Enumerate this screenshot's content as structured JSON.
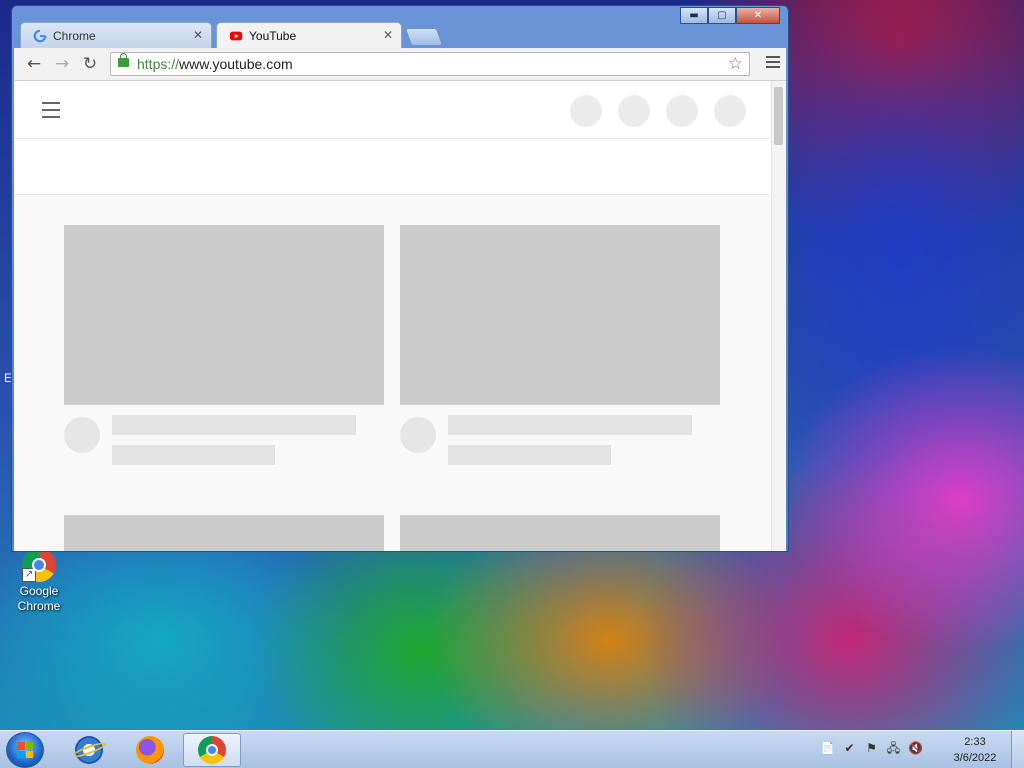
{
  "desktop": {
    "icons": [
      {
        "label_line1": "Google",
        "label_line2": "Chrome"
      }
    ],
    "stray_char": "E"
  },
  "browser": {
    "window_buttons": {
      "minimize": "▬",
      "maximize": "▢",
      "close": "✕"
    },
    "tabs": [
      {
        "title": "Chrome",
        "active": false,
        "favicon": "google-g-icon"
      },
      {
        "title": "YouTube",
        "active": true,
        "favicon": "youtube-icon"
      }
    ],
    "tab_close_glyph": "✕",
    "toolbar": {
      "back_glyph": "←",
      "forward_glyph": "→",
      "reload_glyph": "↻",
      "url_scheme": "https://",
      "url_rest": "www.youtube.com",
      "star_glyph": "☆"
    }
  },
  "taskbar": {
    "pinned": [
      {
        "name": "internet-explorer-icon"
      },
      {
        "name": "firefox-icon"
      },
      {
        "name": "chrome-icon",
        "active": true
      }
    ],
    "tray_icons": [
      "📄",
      "✔",
      "⚑",
      "🖧",
      "🔇"
    ],
    "clock": {
      "time": "2:33",
      "date": "3/6/2022"
    }
  },
  "colors": {
    "accent": "#4e7fc9",
    "youtube_red": "#ff0000"
  }
}
